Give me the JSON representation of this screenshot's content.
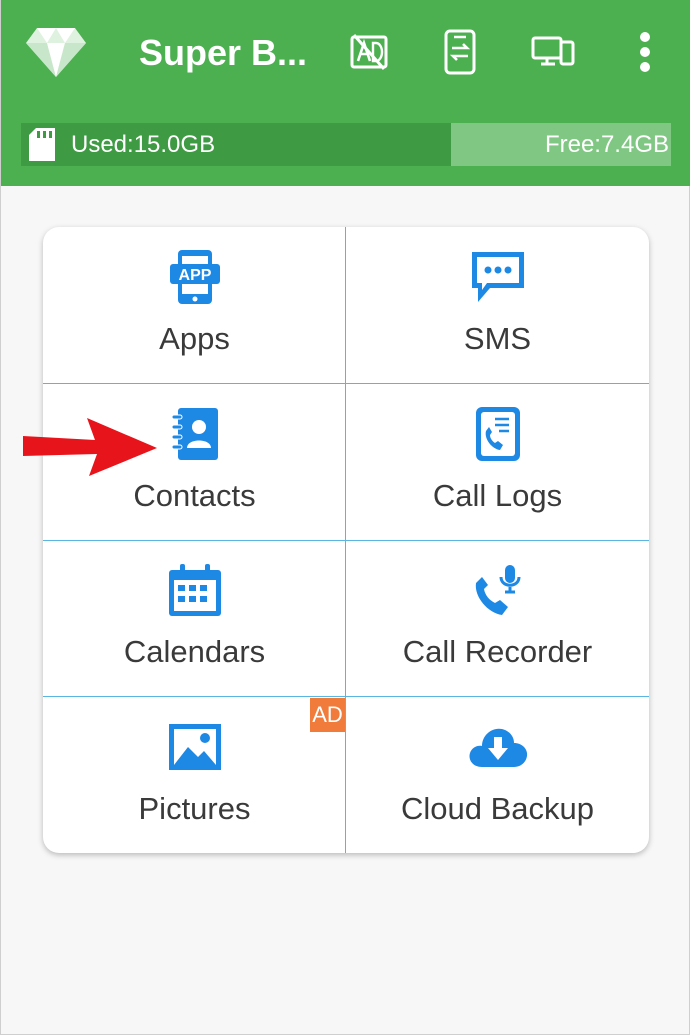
{
  "app": {
    "title": "Super B...",
    "icons": {
      "logo": "diamond-logo",
      "actions": [
        "no-ad-icon",
        "phone-transfer-icon",
        "devices-icon",
        "more-vert-icon"
      ]
    }
  },
  "storage": {
    "used_label": "Used:15.0GB",
    "free_label": "Free:7.4GB",
    "used_fraction": 0.66,
    "icon": "sd-card-icon"
  },
  "tiles": [
    {
      "label": "Apps",
      "icon": "app-phone-icon"
    },
    {
      "label": "SMS",
      "icon": "sms-bubble-icon"
    },
    {
      "label": "Contacts",
      "icon": "contacts-book-icon"
    },
    {
      "label": "Call Logs",
      "icon": "call-log-icon"
    },
    {
      "label": "Calendars",
      "icon": "calendar-icon"
    },
    {
      "label": "Call Recorder",
      "icon": "call-recorder-icon"
    },
    {
      "label": "Pictures",
      "icon": "picture-icon"
    },
    {
      "label": "Cloud Backup",
      "icon": "cloud-download-icon"
    }
  ],
  "ad_badge": "AD",
  "colors": {
    "appbar": "#4caf50",
    "accent_blue": "#1e88e5",
    "ad_orange": "#f07b3b",
    "arrow_red": "#e8141b"
  }
}
